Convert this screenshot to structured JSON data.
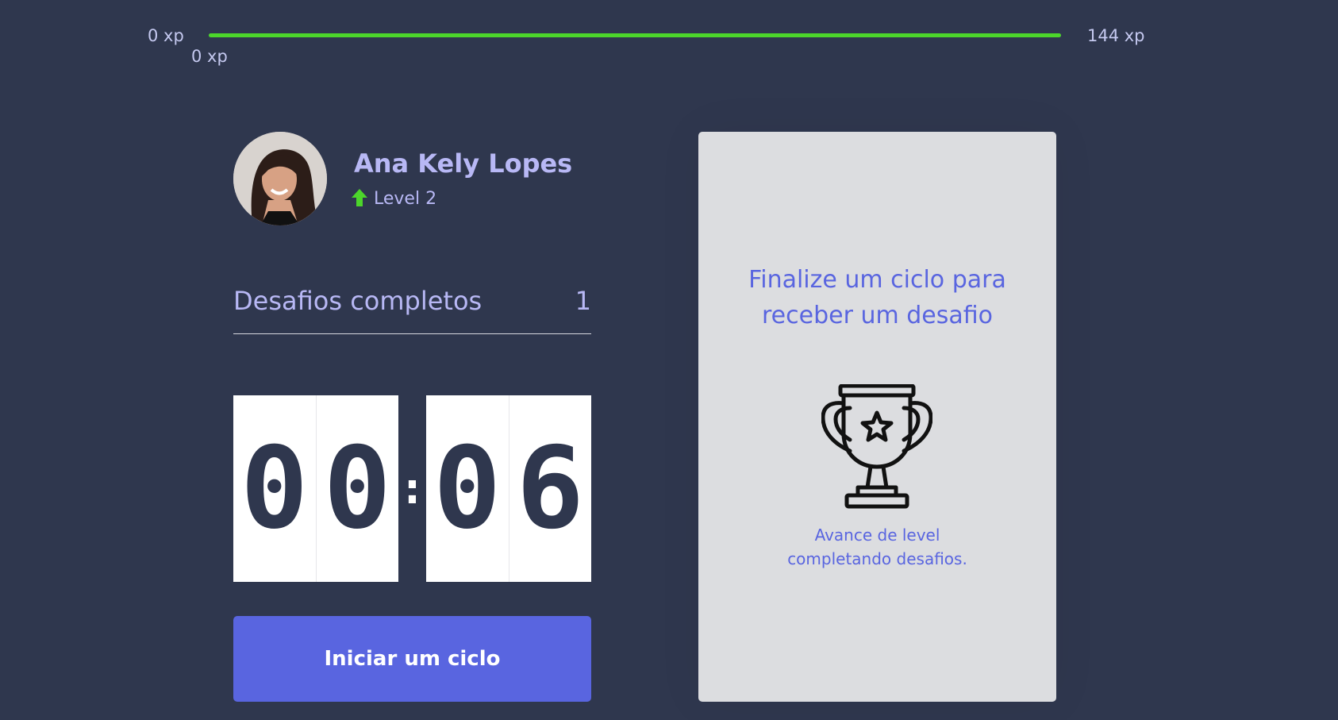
{
  "experience": {
    "start_label": "0 xp",
    "current_label": "0 xp",
    "end_label": "144 xp",
    "progress_percent": 100,
    "bar_color": "#4cd62b"
  },
  "profile": {
    "name": "Ana Kely Lopes",
    "level_label": "Level 2",
    "level_icon": "level-up-arrow-icon",
    "level_icon_color": "#4cd62b"
  },
  "challenges": {
    "label": "Desafios completos",
    "count": "1"
  },
  "countdown": {
    "minutes": [
      "0",
      "0"
    ],
    "separator": ":",
    "seconds": [
      "0",
      "6"
    ]
  },
  "start_button": {
    "label": "Iniciar um ciclo",
    "color": "#5965e0"
  },
  "challenge_box": {
    "title_line_1": "Finalize um ciclo para",
    "title_line_2": "receber um desafio",
    "icon": "trophy-icon",
    "hint_line_1": "Avance de level",
    "hint_line_2": "completando desafios."
  },
  "colors": {
    "background": "#2f374e",
    "accent": "#5965e0",
    "text_light": "#b8b8f5"
  }
}
